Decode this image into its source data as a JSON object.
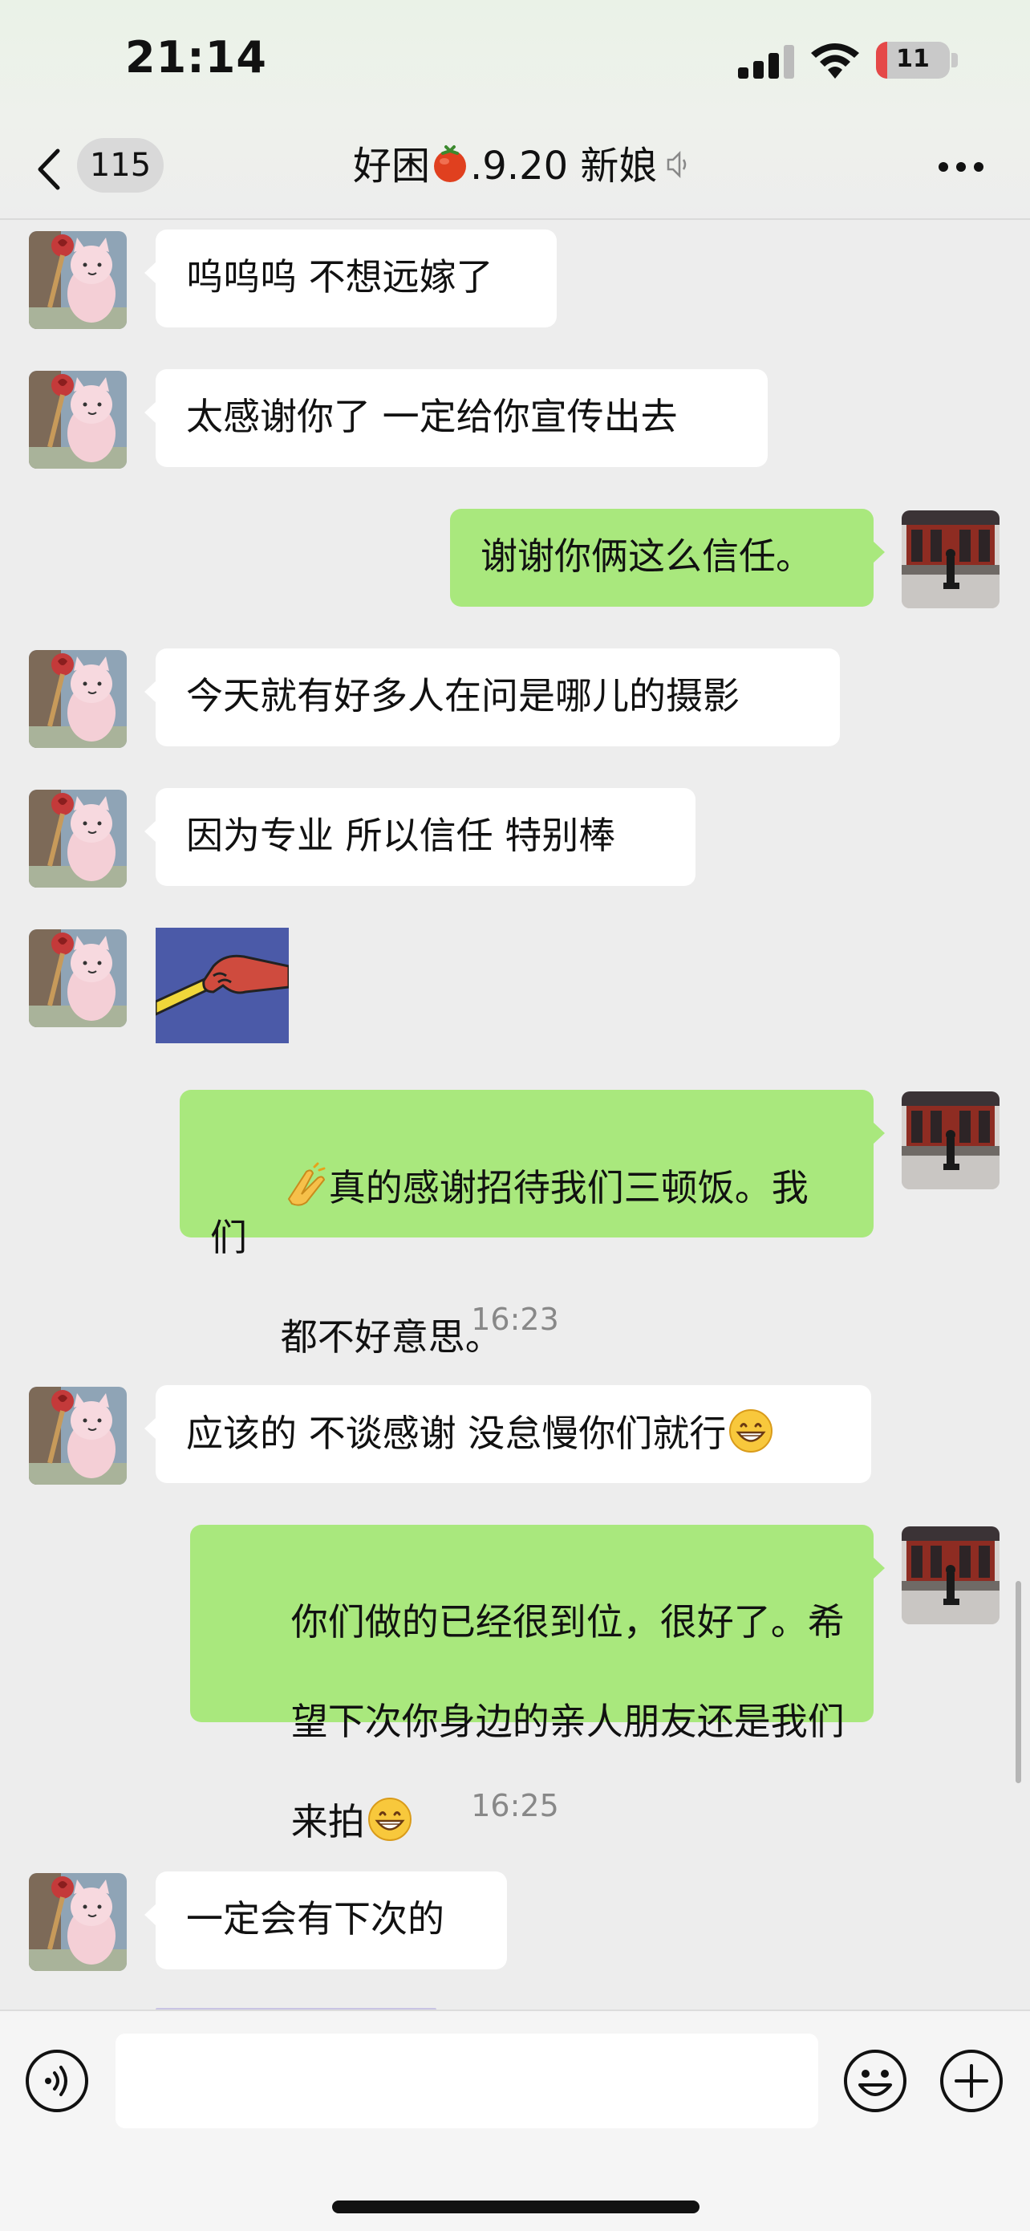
{
  "status_bar": {
    "time": "21:14",
    "battery_level": "11",
    "battery_color": "#e54848"
  },
  "nav": {
    "unread_count": "115",
    "title_prefix": "好困",
    "title_emoji": "tomato-icon",
    "title_suffix": ".9.20 新娘",
    "muted_icon": "muted-bell-icon"
  },
  "colors": {
    "background": "#ededed",
    "incoming_bubble": "#ffffff",
    "outgoing_bubble": "#a9e87d"
  },
  "messages": [
    {
      "side": "in",
      "text": "呜呜呜 不想远嫁了"
    },
    {
      "side": "in",
      "text": "太感谢你了 一定给你宣传出去"
    },
    {
      "side": "out",
      "text": "谢谢你俩这么信任。"
    },
    {
      "side": "in",
      "text": "今天就有好多人在问是哪儿的摄影"
    },
    {
      "side": "in",
      "text": "因为专业 所以信任 特别棒"
    },
    {
      "side": "in",
      "type": "sticker",
      "sticker": "handshake-sticker"
    },
    {
      "side": "out",
      "emoji_prefix": "clapping-hands-emoji",
      "text_line1": "真的感谢招待我们三顿饭。我们",
      "text_line2": "都不好意思。"
    },
    {
      "side": "in",
      "text": "应该的 不谈感谢 没怠慢你们就行",
      "emoji_suffix": "grinning-face-emoji"
    },
    {
      "side": "out",
      "text_line1": "你们做的已经很到位，很好了。希",
      "text_line2": "望下次你身边的亲人朋友还是我们",
      "text_line3": "来拍",
      "emoji_suffix": "grinning-face-emoji"
    },
    {
      "side": "in",
      "text": "一定会有下次的"
    }
  ],
  "timestamps": {
    "t1": "16:23",
    "t2": "16:25"
  },
  "input": {
    "value": "",
    "placeholder": ""
  }
}
